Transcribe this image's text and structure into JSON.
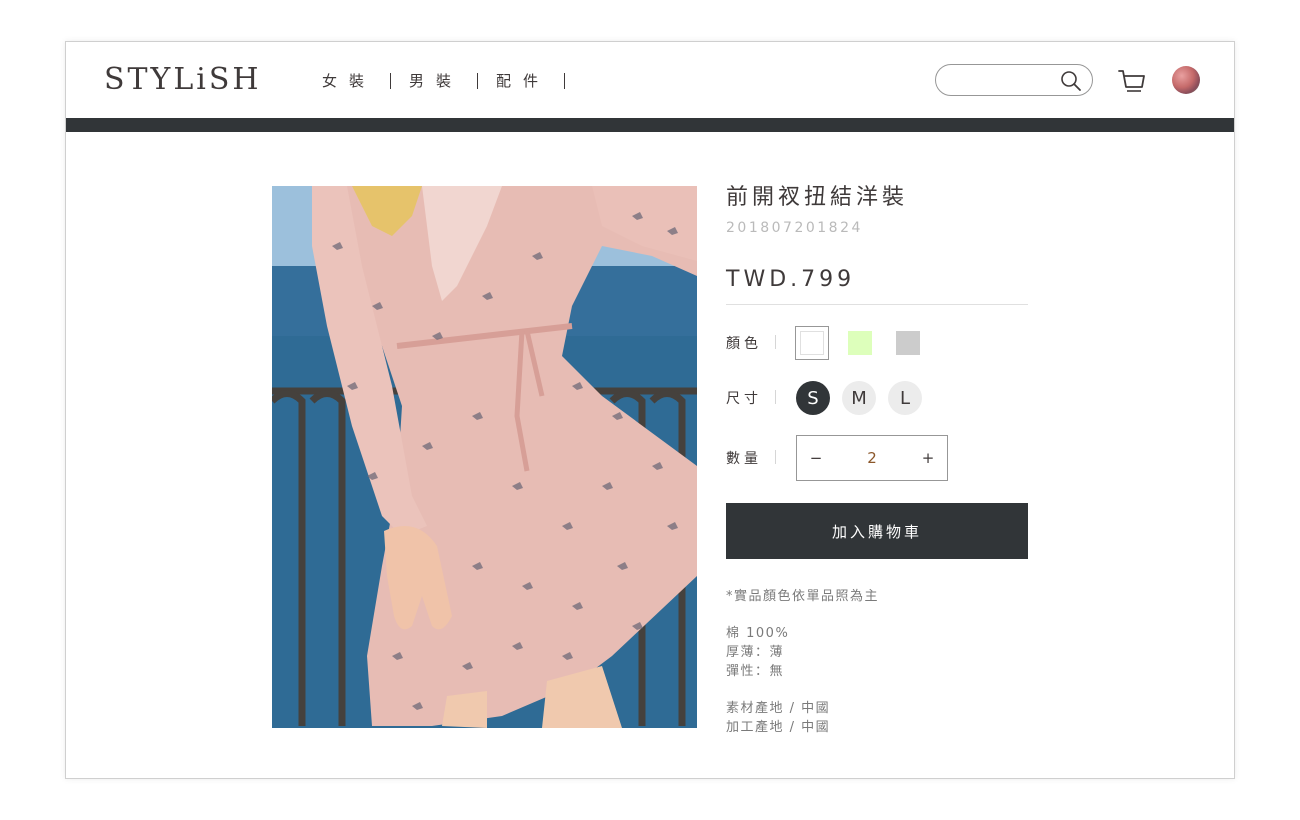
{
  "brand": {
    "logo_text": "STYLiSH"
  },
  "nav": {
    "items": [
      {
        "label": "女裝"
      },
      {
        "label": "男裝"
      },
      {
        "label": "配件"
      }
    ]
  },
  "search": {
    "value": "",
    "placeholder": ""
  },
  "icons": {
    "search": "search-icon",
    "cart": "cart-icon",
    "avatar": "user-avatar"
  },
  "product": {
    "title": "前開衩扭結洋裝",
    "id": "201807201824",
    "price": "TWD.799",
    "color_label": "顏色",
    "colors": [
      {
        "hex": "#FFFFFF",
        "selected": true
      },
      {
        "hex": "#DDFFBB",
        "selected": false
      },
      {
        "hex": "#CCCCCC",
        "selected": false
      }
    ],
    "size_label": "尺寸",
    "sizes": [
      {
        "label": "S",
        "selected": true
      },
      {
        "label": "M",
        "selected": false
      },
      {
        "label": "L",
        "selected": false
      }
    ],
    "quantity_label": "數量",
    "quantity": {
      "minus": "−",
      "value": "2",
      "plus": "+"
    },
    "add_to_cart": "加入購物車",
    "note": "*實品顏色依單品照為主",
    "material": [
      "棉 100%",
      "厚薄：薄",
      "彈性：無"
    ],
    "origin": [
      "素材產地 / 中國",
      "加工產地 / 中國"
    ]
  },
  "colors": {
    "primary_text": "#3F3A3A",
    "dark_bar": "#313538",
    "muted_text": "#BABABA",
    "quantity_text": "#8B572A"
  }
}
